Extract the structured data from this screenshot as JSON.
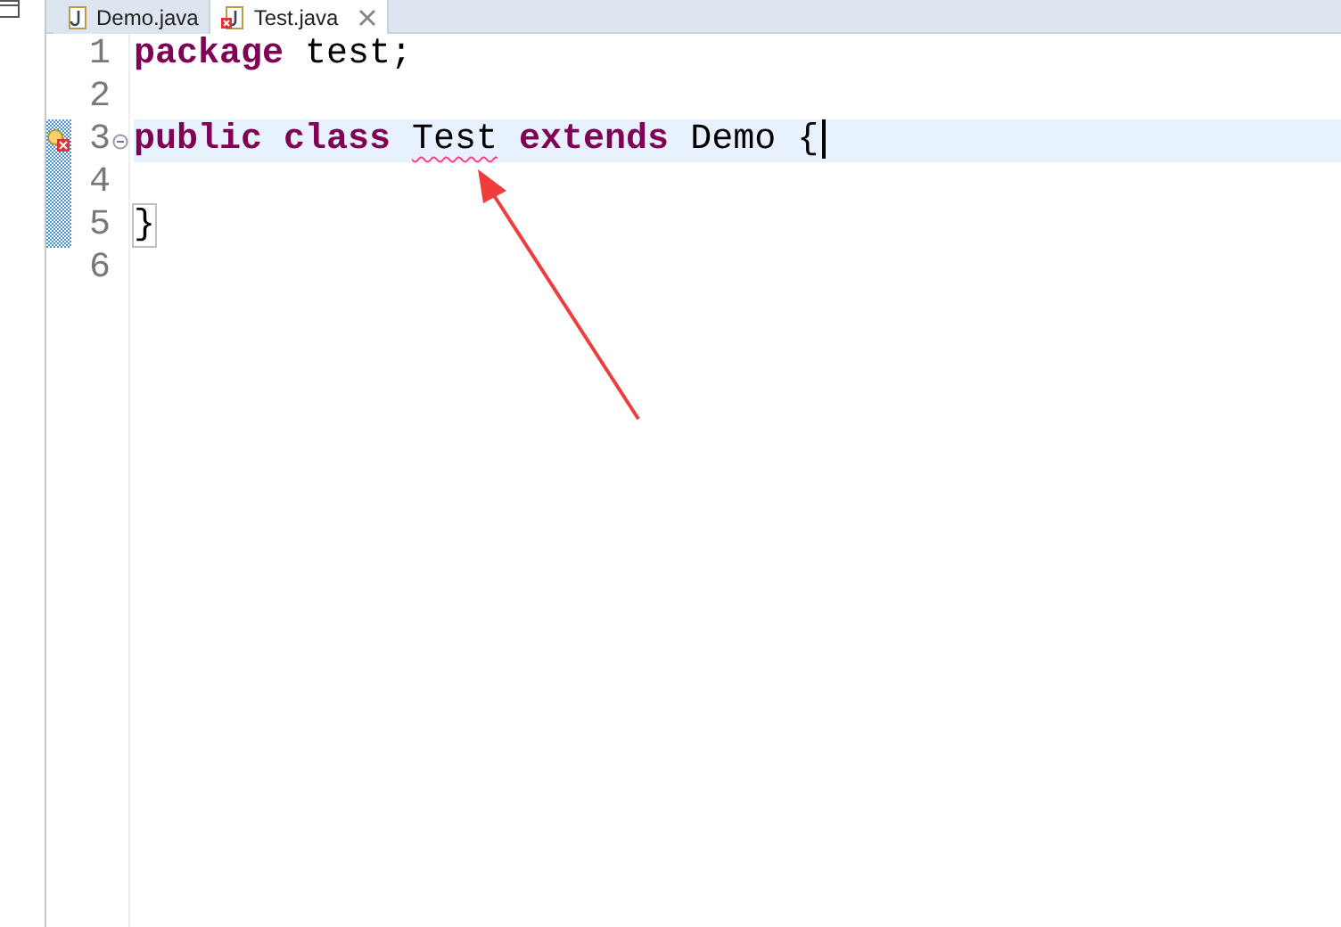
{
  "tabs": [
    {
      "label": "Demo.java",
      "selected": false,
      "error": false,
      "closable": false
    },
    {
      "label": "Test.java",
      "selected": true,
      "error": true,
      "closable": true
    }
  ],
  "lines": [
    {
      "number": "1",
      "current": false,
      "changed": false,
      "tokens": [
        {
          "text": "package",
          "kind": "keyword"
        },
        {
          "text": "test;",
          "kind": "plain"
        }
      ]
    },
    {
      "number": "2",
      "current": false,
      "changed": false
    },
    {
      "number": "3",
      "current": true,
      "changed": true,
      "error": true,
      "folding": true,
      "tokens": [
        {
          "text": "public",
          "kind": "keyword"
        },
        {
          "text": "class",
          "kind": "keyword"
        },
        {
          "text": "Test",
          "kind": "error"
        },
        {
          "text": "extends",
          "kind": "keyword"
        },
        {
          "text": "Demo",
          "kind": "plain"
        },
        {
          "text": "{",
          "kind": "plain",
          "caret": true
        }
      ]
    },
    {
      "number": "4",
      "current": false,
      "changed": true
    },
    {
      "number": "5",
      "current": false,
      "changed": true,
      "tokens": [
        {
          "text": "}",
          "kind": "matched"
        }
      ]
    },
    {
      "number": "6",
      "current": false,
      "changed": false
    }
  ]
}
